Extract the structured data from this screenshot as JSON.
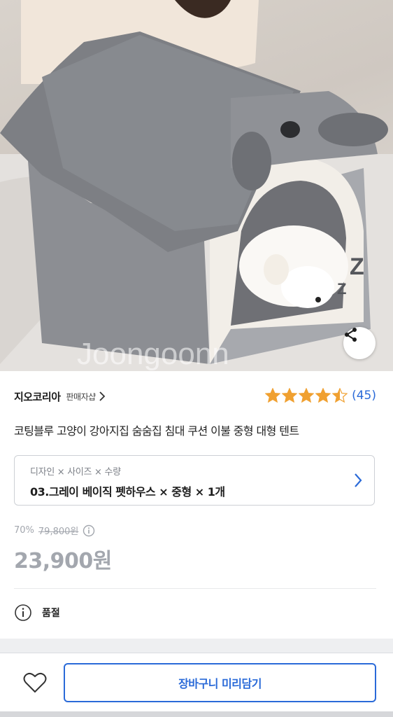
{
  "hero": {
    "watermark": "Joongoonn"
  },
  "seller": {
    "name": "지오코리아",
    "sub": "판매자샵"
  },
  "rating": {
    "value": 4.5,
    "out_of": 5,
    "count": "(45)"
  },
  "product": {
    "title": "코팅블루 고양이 강아지집 숨숨집 침대 쿠션 이불 중형 대형 텐트"
  },
  "option": {
    "label": "디자인 × 사이즈 × 수량",
    "value": "03.그레이 베이직 펫하우스 × 중형 × 1개"
  },
  "price": {
    "discount": "70%",
    "original": "79,800원",
    "sale": "23,900원"
  },
  "status": {
    "text": "품절"
  },
  "bottom": {
    "cart_label": "장바구니 미리담기"
  },
  "colors": {
    "accent": "#2a6ad8",
    "star": "#f0a030",
    "price_gray": "#a3a7ae"
  },
  "icons": {
    "share": "share-icon",
    "chevron": "chevron-right-icon",
    "info": "info-icon",
    "heart": "heart-icon",
    "star": "star-icon"
  }
}
